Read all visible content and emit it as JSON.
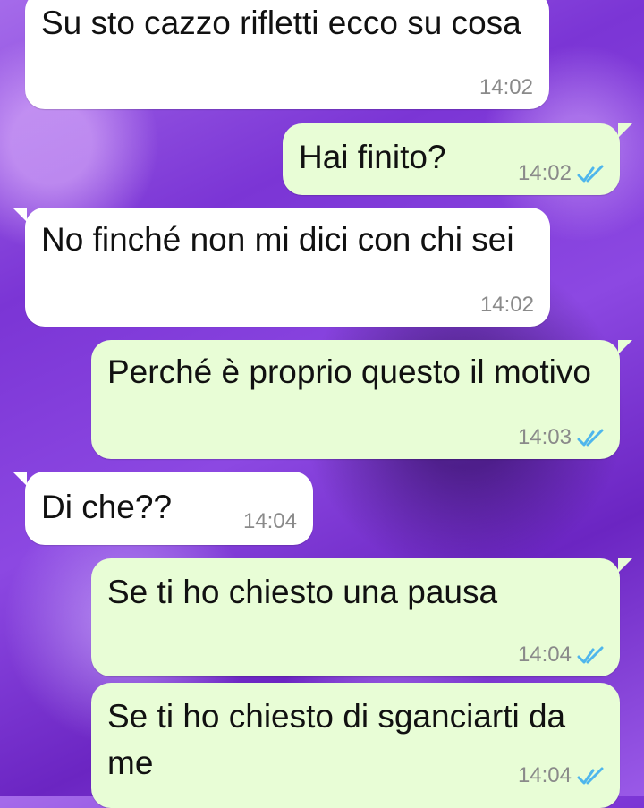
{
  "messages": [
    {
      "text": "Su sto cazzo rifletti ecco su cosa",
      "time": "14:02"
    },
    {
      "text": "Hai finito?",
      "time": "14:02"
    },
    {
      "text": "No finché non mi dici con chi sei",
      "time": "14:02"
    },
    {
      "text": "Perché è proprio questo il motivo",
      "time": "14:03"
    },
    {
      "text": "Di che??",
      "time": "14:04"
    },
    {
      "text": "Se ti ho chiesto una pausa",
      "time": "14:04"
    },
    {
      "text": "Se ti ho chiesto di sganciarti da me",
      "time": "14:04"
    }
  ],
  "colors": {
    "incoming_bubble": "#ffffff",
    "outgoing_bubble": "#e8fdd6",
    "time_text": "#8a8a8a",
    "read_ticks": "#4fb6ec"
  }
}
